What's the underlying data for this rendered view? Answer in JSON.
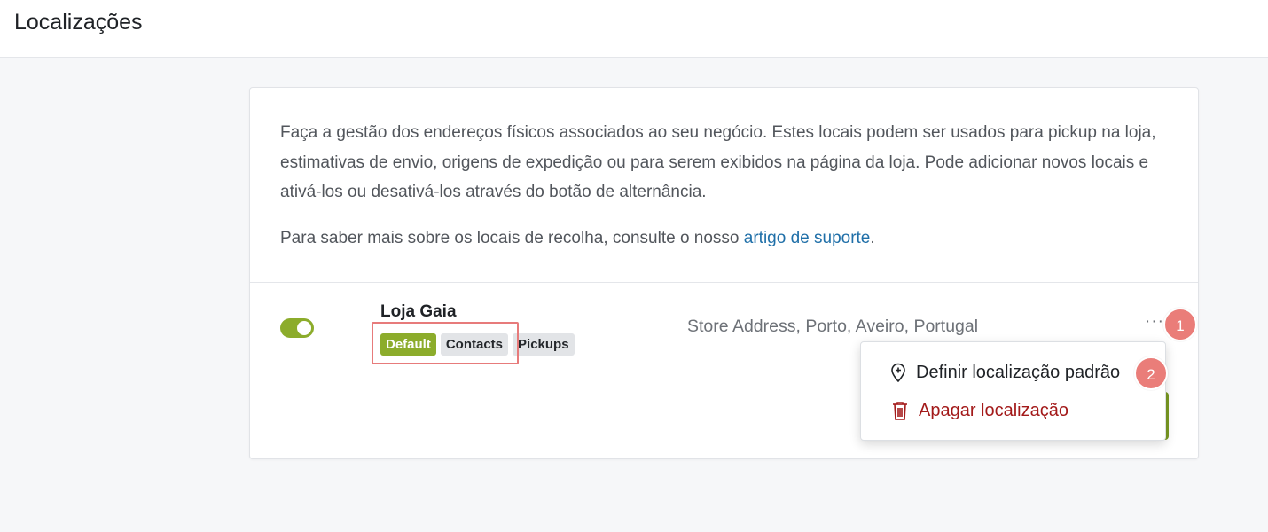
{
  "header": {
    "title": "Localizações"
  },
  "intro": {
    "text": "Faça a gestão dos endereços físicos associados ao seu negócio. Estes locais podem ser usados para pickup na loja, estimativas de envio, origens de expedição ou para serem exibidos na página da loja. Pode adicionar novos locais e ativá-los ou desativá-los através do botão de alternância.",
    "support_prefix": "Para saber mais sobre os locais de recolha, consulte o nosso ",
    "support_link": "artigo de suporte",
    "support_suffix": "."
  },
  "location": {
    "enabled": true,
    "name": "Loja Gaia",
    "tags": [
      "Default",
      "Contacts",
      "Pickups"
    ],
    "address": "Store Address, Porto, Aveiro, Portugal",
    "more_label": "···"
  },
  "menu": {
    "set_default": "Definir localização padrão",
    "delete": "Apagar localização"
  },
  "annotations": {
    "badge1": "1",
    "badge2": "2"
  },
  "colors": {
    "accent": "#8cac2b",
    "link": "#1f6fa8",
    "danger": "#a31a1a",
    "badge": "#ea7d79",
    "highlight": "#e77b7b"
  },
  "icons": {
    "set_default": "map-pin-icon",
    "delete": "trash-icon"
  }
}
